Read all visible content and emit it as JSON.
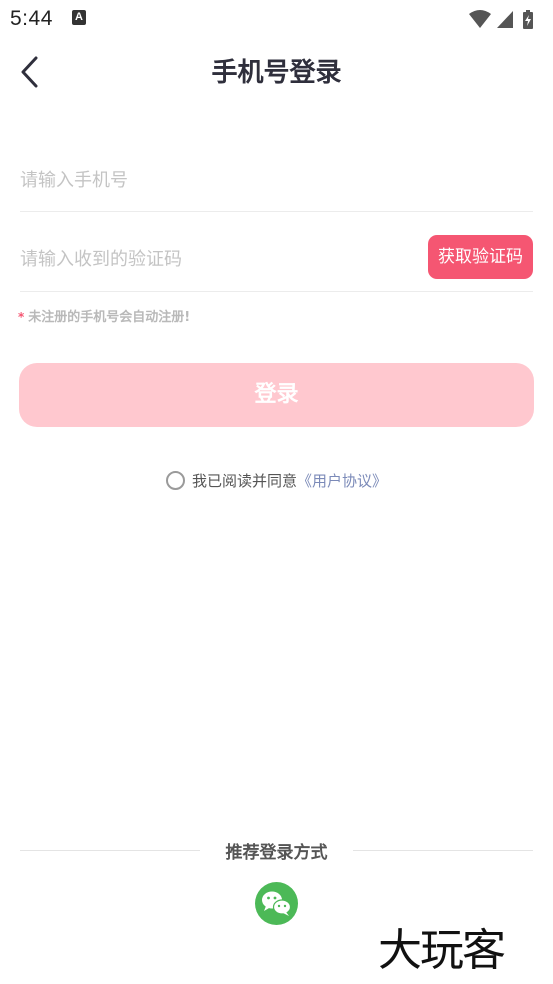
{
  "status_bar": {
    "time": "5:44",
    "notification_letter": "A",
    "icons": [
      "wifi-icon",
      "signal-icon",
      "battery-charging-icon"
    ]
  },
  "header": {
    "title": "手机号登录",
    "back_icon": "chevron-left-icon"
  },
  "form": {
    "phone_placeholder": "请输入手机号",
    "phone_value": "",
    "code_placeholder": "请输入收到的验证码",
    "code_value": "",
    "get_code_label": "获取验证码",
    "notice_star": "*",
    "notice_text": "未注册的手机号会自动注册!",
    "login_label": "登录"
  },
  "agreement": {
    "text": "我已阅读并同意",
    "link": "《用户协议》"
  },
  "recommend": {
    "label": "推荐登录方式",
    "wechat_icon": "wechat-icon"
  },
  "watermark": {
    "text": "大玩客"
  },
  "colors": {
    "accent": "#f55672",
    "login_disabled": "#ffc8cf",
    "link": "#7b8ab8",
    "wechat": "#4cb957"
  }
}
